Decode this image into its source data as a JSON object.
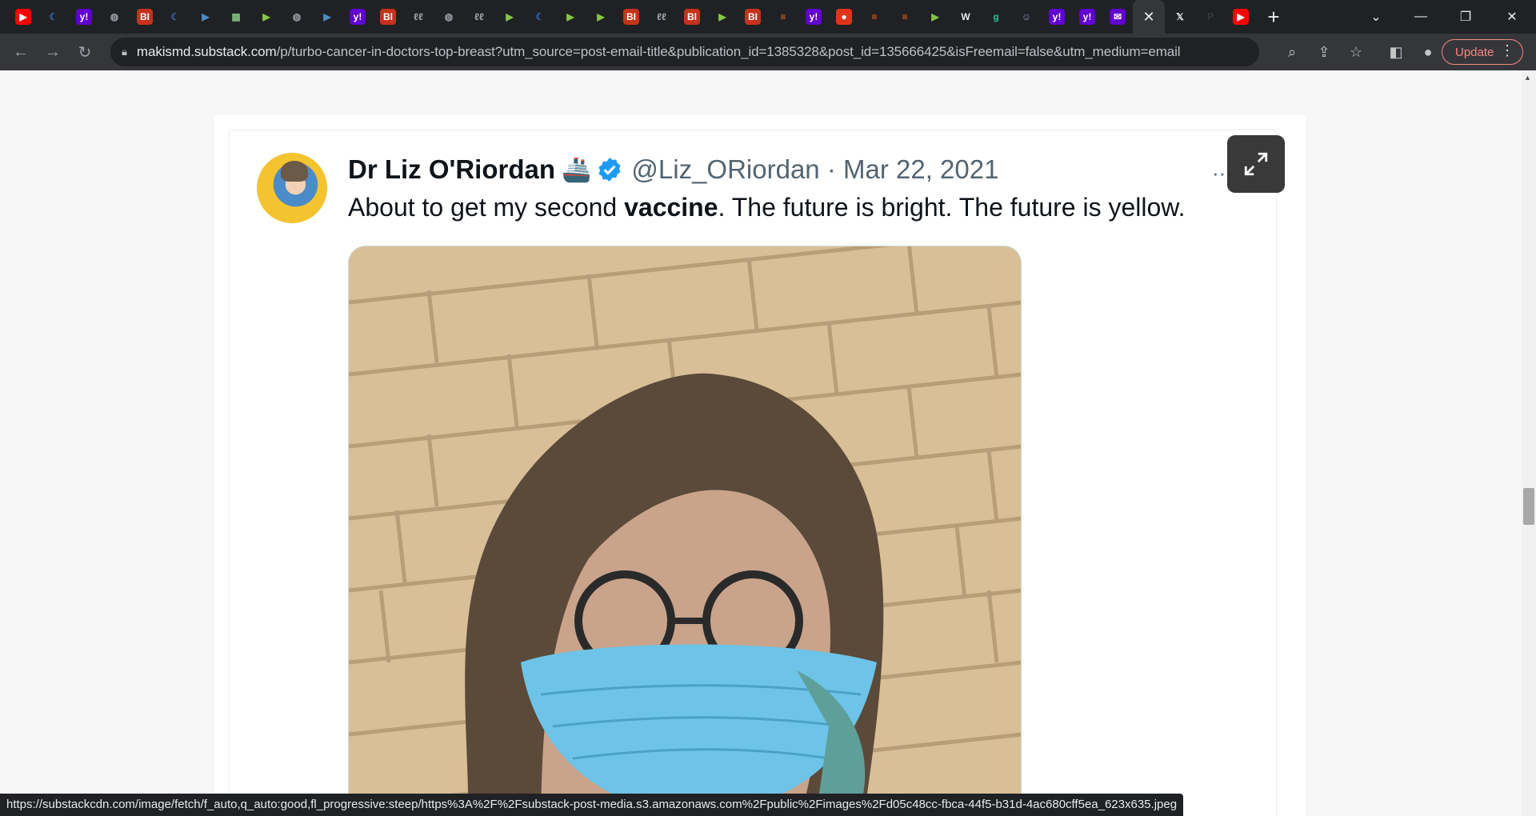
{
  "browser": {
    "tabs": [
      {
        "icon": "youtube-icon",
        "color": "#ff0000",
        "glyph": "▶"
      },
      {
        "icon": "shield-icon",
        "color": "#2e6fbf",
        "glyph": "☾"
      },
      {
        "icon": "yahoo-icon",
        "color": "#6001d2",
        "glyph": "y!"
      },
      {
        "icon": "globe-icon",
        "color": "#9aa0a6",
        "glyph": "◍"
      },
      {
        "icon": "bi-icon",
        "color": "#c4331b",
        "glyph": "BI"
      },
      {
        "icon": "shield-icon",
        "color": "#2e6fbf",
        "glyph": "☾"
      },
      {
        "icon": "bookmark-icon",
        "color": "#4a8bc9",
        "glyph": "▶"
      },
      {
        "icon": "map-icon",
        "color": "#7fbf7f",
        "glyph": "▦"
      },
      {
        "icon": "rumble-icon",
        "color": "#85c742",
        "glyph": "▶"
      },
      {
        "icon": "globe-icon",
        "color": "#9aa0a6",
        "glyph": "◍"
      },
      {
        "icon": "bookmark-icon",
        "color": "#4a8bc9",
        "glyph": "▶"
      },
      {
        "icon": "yahoo-icon",
        "color": "#6001d2",
        "glyph": "y!"
      },
      {
        "icon": "bi-icon",
        "color": "#c4331b",
        "glyph": "BI"
      },
      {
        "icon": "script-icon",
        "color": "#9aa0a6",
        "glyph": "ℓℓ"
      },
      {
        "icon": "globe-icon",
        "color": "#9aa0a6",
        "glyph": "◍"
      },
      {
        "icon": "script-icon",
        "color": "#9aa0a6",
        "glyph": "ℓℓ"
      },
      {
        "icon": "rumble-icon",
        "color": "#85c742",
        "glyph": "▶"
      },
      {
        "icon": "shield-icon",
        "color": "#2e6fbf",
        "glyph": "☾"
      },
      {
        "icon": "rumble-icon",
        "color": "#85c742",
        "glyph": "▶"
      },
      {
        "icon": "rumble-icon",
        "color": "#85c742",
        "glyph": "▶"
      },
      {
        "icon": "bi-icon",
        "color": "#c4331b",
        "glyph": "BI"
      },
      {
        "icon": "script-icon",
        "color": "#9aa0a6",
        "glyph": "ℓℓ"
      },
      {
        "icon": "bi-icon",
        "color": "#c4331b",
        "glyph": "BI"
      },
      {
        "icon": "rumble-icon",
        "color": "#85c742",
        "glyph": "▶"
      },
      {
        "icon": "bi-icon",
        "color": "#c4331b",
        "glyph": "BI"
      },
      {
        "icon": "substack-icon",
        "color": "#ff6719",
        "glyph": "≡"
      },
      {
        "icon": "yahoo-icon",
        "color": "#6001d2",
        "glyph": "y!"
      },
      {
        "icon": "podcast-icon",
        "color": "#e0341a",
        "glyph": "●"
      },
      {
        "icon": "substack-icon",
        "color": "#ff6719",
        "glyph": "≡"
      },
      {
        "icon": "substack-icon",
        "color": "#ff6719",
        "glyph": "≡"
      },
      {
        "icon": "rumble-icon",
        "color": "#85c742",
        "glyph": "▶"
      },
      {
        "icon": "news-icon",
        "color": "#e8eaed",
        "glyph": "W"
      },
      {
        "icon": "grammarly-icon",
        "color": "#15c39a",
        "glyph": "g"
      },
      {
        "icon": "profile-icon",
        "color": "#8a9bbd",
        "glyph": "☺"
      },
      {
        "icon": "yahoo-icon",
        "color": "#6001d2",
        "glyph": "y!"
      },
      {
        "icon": "yahoo-icon",
        "color": "#6001d2",
        "glyph": "y!"
      },
      {
        "icon": "yahoo-mail-icon",
        "color": "#6001d2",
        "glyph": "✉"
      },
      {
        "icon": "close-icon",
        "color": "#e8eaed",
        "glyph": "✕",
        "active": true
      },
      {
        "icon": "x-icon",
        "color": "#e8eaed",
        "glyph": "𝕏"
      },
      {
        "icon": "patreon-icon",
        "color": "#3a3a3a",
        "glyph": "P"
      },
      {
        "icon": "youtube-icon",
        "color": "#ff0000",
        "glyph": "▶"
      }
    ],
    "url_host": "makismd.substack.com",
    "url_path": "/p/turbo-cancer-in-doctors-top-breast?utm_source=post-email-title&publication_id=1385328&post_id=135666425&isFreemail=false&utm_medium=email",
    "update_label": "Update",
    "status_url": "https://substackcdn.com/image/fetch/f_auto,q_auto:good,fl_progressive:steep/https%3A%2F%2Fsubstack-post-media.s3.amazonaws.com%2Fpublic%2Fimages%2Fd05c48cc-fbca-44f5-b31d-4ac680cff5ea_623x635.jpeg"
  },
  "tweet": {
    "author_name": "Dr Liz O'Riordan",
    "author_emoji": "🚢",
    "handle": "@Liz_ORiordan",
    "separator": " · ",
    "date": "Mar 22, 2021",
    "text_before": "About to get my second ",
    "text_bold": "vaccine",
    "text_after": ". The future is bright. The future is yellow.",
    "more": "···"
  },
  "colors": {
    "verified": "#1d9bf0",
    "update_accent": "#f28b82"
  }
}
